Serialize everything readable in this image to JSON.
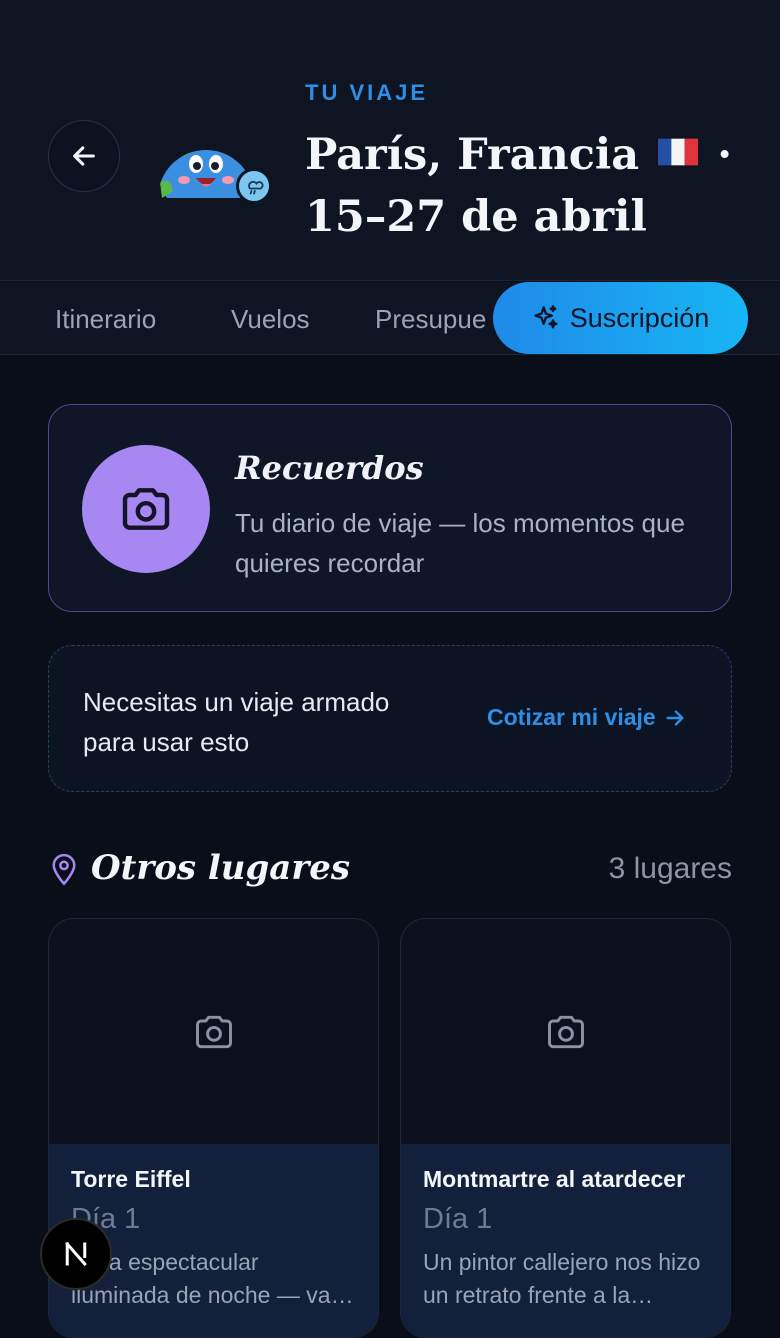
{
  "header": {
    "eyebrow": "TU VIAJE",
    "title_line1": "París, Francia",
    "title_sep": "·",
    "title_line2": "15–27 de abril"
  },
  "tabs": [
    {
      "label": "Itinerario"
    },
    {
      "label": "Vuelos"
    },
    {
      "label": "Presupuesto"
    }
  ],
  "subscription_button": {
    "label": "Suscripción",
    "icon": "sparkles-icon"
  },
  "memories": {
    "title": "Recuerdos",
    "description": "Tu diario de viaje — los momentos que quieres recordar",
    "icon": "camera-icon",
    "icon_bg": "#a788f2"
  },
  "notice": {
    "text": "Necesitas un viaje armado para usar esto",
    "link_label": "Cotizar mi viaje"
  },
  "places": {
    "title": "Otros lugares",
    "count": "3 lugares",
    "items": [
      {
        "title": "Torre Eiffel",
        "day": "Día 1",
        "description": "Vista espectacular iluminada de noche — vale la pena"
      },
      {
        "title": "Montmartre al atardecer",
        "day": "Día 1",
        "description": "Un pintor callejero nos hizo un retrato frente a la basílica"
      }
    ]
  },
  "fab": {
    "label": "N"
  },
  "colors": {
    "accent": "#2f8ee6",
    "subscription_gradient_start": "#1f8ae8",
    "subscription_gradient_end": "#17b6f5",
    "background": "#0a0e18"
  }
}
